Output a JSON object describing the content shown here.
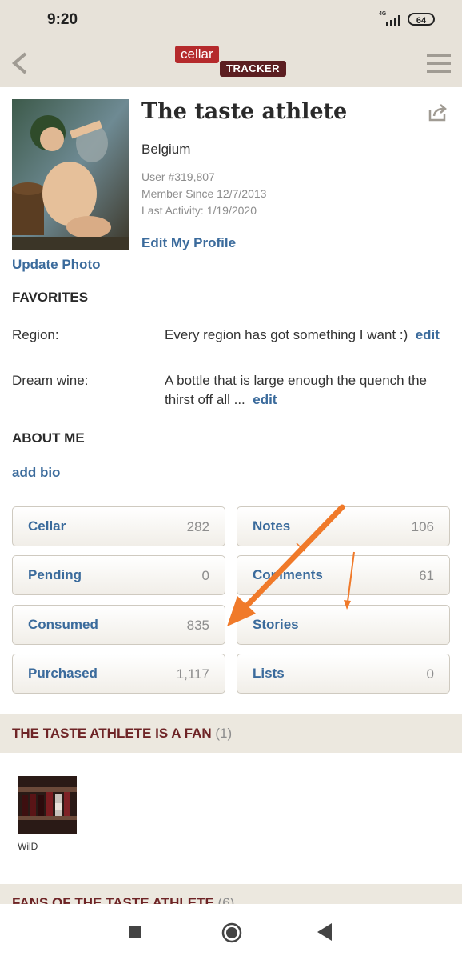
{
  "status_bar": {
    "time": "9:20",
    "network": "4G",
    "battery": "64"
  },
  "app": {
    "logo_top": "cellar",
    "logo_bottom": "TRACKER"
  },
  "profile": {
    "name": "The taste athlete",
    "country": "Belgium",
    "user_number": "User #319,807",
    "member_since": "Member Since 12/7/2013",
    "last_activity": "Last Activity: 1/19/2020",
    "edit_profile": "Edit My Profile",
    "update_photo": "Update Photo"
  },
  "favorites": {
    "heading": "FAVORITES",
    "region_label": "Region:",
    "region_value": "Every region has got something I want :)",
    "dream_label": "Dream wine:",
    "dream_value": "A bottle that is large enough the quench the thirst off all ...",
    "edit": "edit"
  },
  "about": {
    "heading": "ABOUT ME",
    "add_bio": "add bio"
  },
  "stats": [
    {
      "label": "Cellar",
      "count": "282"
    },
    {
      "label": "Notes",
      "count": "106"
    },
    {
      "label": "Pending",
      "count": "0"
    },
    {
      "label": "Comments",
      "count": "61"
    },
    {
      "label": "Consumed",
      "count": "835"
    },
    {
      "label": "Stories",
      "count": ""
    },
    {
      "label": "Purchased",
      "count": "1,117"
    },
    {
      "label": "Lists",
      "count": "0"
    }
  ],
  "fan_section": {
    "title": "THE TASTE ATHLETE IS A FAN",
    "count": "(1)",
    "fan_name": "WilD"
  },
  "fans_of_section": {
    "title": "FANS OF THE TASTE ATHLETE",
    "count": "(6)"
  },
  "colors": {
    "accent_link": "#3b6b9c",
    "header_bg": "#e7e2d9",
    "arrow": "#f07a2a",
    "section_title": "#6e2426"
  },
  "icons": [
    "back-arrow-icon",
    "hamburger-menu-icon",
    "share-icon",
    "square-nav-icon",
    "home-circle-icon",
    "back-triangle-icon"
  ]
}
